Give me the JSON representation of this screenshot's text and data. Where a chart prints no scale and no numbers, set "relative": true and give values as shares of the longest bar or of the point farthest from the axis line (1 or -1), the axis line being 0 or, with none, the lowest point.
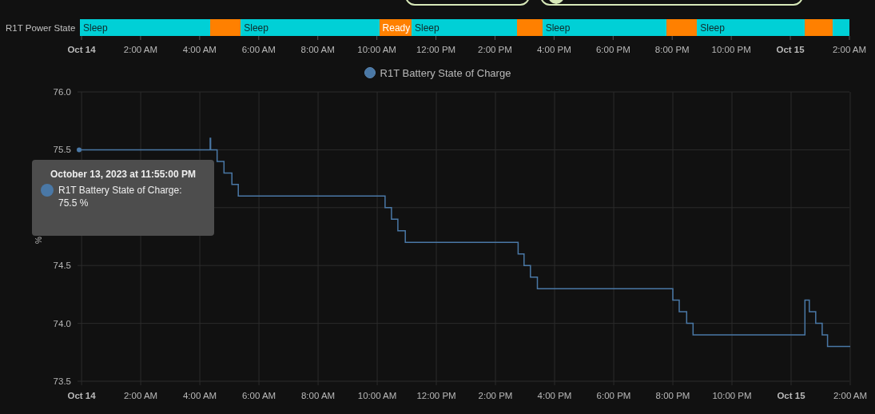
{
  "top_chips": [
    {
      "kind": "plain"
    },
    {
      "kind": "toggle"
    }
  ],
  "power_state": {
    "chart_data": {
      "type": "bar",
      "orientation": "horizontal",
      "stacked": true,
      "categories": [
        "R1T Power State"
      ],
      "relative": true,
      "series": [
        {
          "name": "Sleep",
          "color": "#00d0d6",
          "values": [
            0.169
          ]
        },
        {
          "color": "#ff8000",
          "values": [
            0.04
          ]
        },
        {
          "name": "Sleep",
          "color": "#00d0d6",
          "values": [
            0.18
          ]
        },
        {
          "name": "Ready",
          "color": "#ff8000",
          "values": [
            0.042
          ]
        },
        {
          "name": "Sleep",
          "color": "#00d0d6",
          "values": [
            0.137
          ]
        },
        {
          "color": "#ff8000",
          "values": [
            0.033
          ]
        },
        {
          "name": "Sleep",
          "color": "#00d0d6",
          "values": [
            0.161
          ]
        },
        {
          "color": "#ff8000",
          "values": [
            0.04
          ]
        },
        {
          "name": "Sleep",
          "color": "#00d0d6",
          "values": [
            0.14
          ]
        },
        {
          "color": "#ff8000",
          "values": [
            0.036
          ]
        },
        {
          "color": "#00d0d6",
          "values": [
            0.022
          ]
        }
      ]
    },
    "ticks": [
      {
        "label": "Oct 14",
        "bold": true
      },
      {
        "label": "2:00 AM",
        "bold": false
      },
      {
        "label": "4:00 AM",
        "bold": false
      },
      {
        "label": "6:00 AM",
        "bold": false
      },
      {
        "label": "8:00 AM",
        "bold": false
      },
      {
        "label": "10:00 AM",
        "bold": false
      },
      {
        "label": "12:00 PM",
        "bold": false
      },
      {
        "label": "2:00 PM",
        "bold": false
      },
      {
        "label": "4:00 PM",
        "bold": false
      },
      {
        "label": "6:00 PM",
        "bold": false
      },
      {
        "label": "8:00 PM",
        "bold": false
      },
      {
        "label": "10:00 PM",
        "bold": false
      },
      {
        "label": "Oct 15",
        "bold": true
      },
      {
        "label": "2:00 AM",
        "bold": false
      }
    ]
  },
  "battery_chart": {
    "chart_data": {
      "type": "line",
      "ylabel": "%",
      "grid": true,
      "x": [
        "2023-10-13T23:55",
        "2023-10-14T04:21",
        "2023-10-14T04:21",
        "2023-10-14T04:22",
        "2023-10-14T04:22",
        "2023-10-14T04:35",
        "2023-10-14T04:35",
        "2023-10-14T04:49",
        "2023-10-14T04:49",
        "2023-10-14T05:05",
        "2023-10-14T05:05",
        "2023-10-14T05:18",
        "2023-10-14T05:18",
        "2023-10-14T10:16",
        "2023-10-14T10:16",
        "2023-10-14T10:29",
        "2023-10-14T10:29",
        "2023-10-14T10:42",
        "2023-10-14T10:42",
        "2023-10-14T10:57",
        "2023-10-14T10:57",
        "2023-10-14T14:46",
        "2023-10-14T14:46",
        "2023-10-14T14:58",
        "2023-10-14T14:58",
        "2023-10-14T15:11",
        "2023-10-14T15:11",
        "2023-10-14T15:25",
        "2023-10-14T15:25",
        "2023-10-14T20:00",
        "2023-10-14T20:00",
        "2023-10-14T20:13",
        "2023-10-14T20:13",
        "2023-10-14T20:28",
        "2023-10-14T20:28",
        "2023-10-14T20:41",
        "2023-10-14T20:41",
        "2023-10-15T00:28",
        "2023-10-15T00:28",
        "2023-10-15T00:37",
        "2023-10-15T00:37",
        "2023-10-15T00:50",
        "2023-10-15T00:50",
        "2023-10-15T01:03",
        "2023-10-15T01:03",
        "2023-10-15T01:14",
        "2023-10-15T01:14",
        "2023-10-15T02:00"
      ],
      "series": [
        {
          "name": "R1T Battery State of Charge",
          "color": "#4a78a6",
          "values": [
            75.5,
            75.5,
            75.6,
            75.6,
            75.5,
            75.5,
            75.4,
            75.4,
            75.3,
            75.3,
            75.2,
            75.2,
            75.1,
            75.1,
            75.0,
            75.0,
            74.9,
            74.9,
            74.8,
            74.8,
            74.7,
            74.7,
            74.6,
            74.6,
            74.5,
            74.5,
            74.4,
            74.4,
            74.3,
            74.3,
            74.2,
            74.2,
            74.1,
            74.1,
            74.0,
            74.0,
            73.9,
            73.9,
            74.2,
            74.2,
            74.1,
            74.1,
            74.0,
            74.0,
            73.9,
            73.9,
            73.8,
            73.8
          ]
        }
      ],
      "xlim": [
        "2023-10-13T23:55",
        "2023-10-15T02:00"
      ],
      "ylim": [
        73.5,
        76.0
      ],
      "xticks": [
        {
          "value": "2023-10-14T00:00",
          "label": "Oct 14"
        },
        {
          "value": "2023-10-14T02:00",
          "label": "2:00 AM"
        },
        {
          "value": "2023-10-14T04:00",
          "label": "4:00 AM"
        },
        {
          "value": "2023-10-14T06:00",
          "label": "6:00 AM"
        },
        {
          "value": "2023-10-14T08:00",
          "label": "8:00 AM"
        },
        {
          "value": "2023-10-14T10:00",
          "label": "10:00 AM"
        },
        {
          "value": "2023-10-14T12:00",
          "label": "12:00 PM"
        },
        {
          "value": "2023-10-14T14:00",
          "label": "2:00 PM"
        },
        {
          "value": "2023-10-14T16:00",
          "label": "4:00 PM"
        },
        {
          "value": "2023-10-14T18:00",
          "label": "6:00 PM"
        },
        {
          "value": "2023-10-14T20:00",
          "label": "8:00 PM"
        },
        {
          "value": "2023-10-14T22:00",
          "label": "10:00 PM"
        },
        {
          "value": "2023-10-15T00:00",
          "label": "Oct 15"
        },
        {
          "value": "2023-10-15T02:00",
          "label": "2:00 AM"
        }
      ],
      "yticks": [
        {
          "value": 73.5,
          "label": "73.5"
        },
        {
          "value": 74.0,
          "label": "74.0"
        },
        {
          "value": 74.5,
          "label": "74.5"
        },
        {
          "value": 75.5,
          "label": "75.5"
        },
        {
          "value": 76.0,
          "label": "76.0"
        }
      ]
    },
    "tooltip": {
      "title": "October 13, 2023 at 11:55:00 PM",
      "series": "R1T Battery State of Charge:",
      "value": "75.5 %"
    }
  }
}
